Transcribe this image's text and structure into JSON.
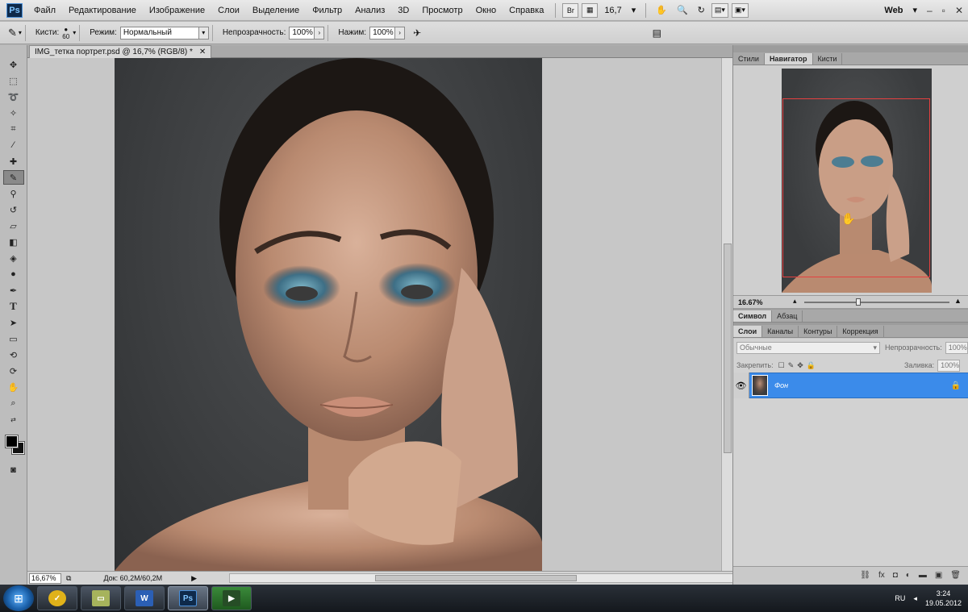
{
  "menubar": {
    "logo": "Ps",
    "items": [
      "Файл",
      "Редактирование",
      "Изображение",
      "Слои",
      "Выделение",
      "Фильтр",
      "Анализ",
      "3D",
      "Просмотр",
      "Окно",
      "Справка"
    ],
    "bridge": "Br",
    "zoom": "16,7",
    "workspace": "Web"
  },
  "optionsbar": {
    "brush_label": "Кисти:",
    "brush_size": "60",
    "mode_label": "Режим:",
    "mode_value": "Нормальный",
    "opacity_label": "Непрозрачность:",
    "opacity_value": "100%",
    "pressure_label": "Нажим:",
    "pressure_value": "100%"
  },
  "document": {
    "tab_title": "IMG_тетка портрет.psd @ 16,7% (RGB/8) *",
    "status_zoom": "16,67%",
    "status_doc": "Док: 60,2M/60,2M"
  },
  "panels": {
    "top_tabs": [
      "Стили",
      "Навигатор",
      "Кисти"
    ],
    "nav_zoom": "16.67%",
    "mid_tabs": [
      "Символ",
      "Абзац"
    ],
    "layer_tabs": [
      "Слои",
      "Каналы",
      "Контуры",
      "Коррекция"
    ],
    "blend_mode": "Обычные",
    "layer_opacity_label": "Непрозрачность:",
    "layer_opacity_value": "100%",
    "lock_label": "Закрепить:",
    "fill_label": "Заливка:",
    "fill_value": "100%",
    "layer_name": "Фон"
  },
  "taskbar": {
    "lang": "RU",
    "time": "3:24",
    "date": "19.05.2012"
  },
  "colors": {
    "active_layer": "#3b8bea",
    "navigator_rect": "#e54040"
  }
}
